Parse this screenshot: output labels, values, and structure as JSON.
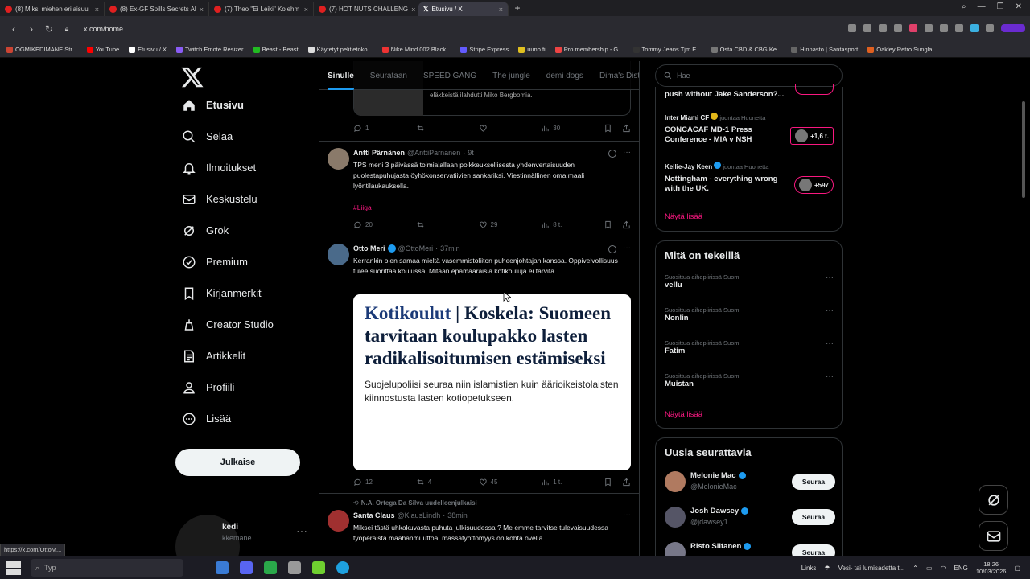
{
  "browser": {
    "tabs": [
      {
        "label": "(8) Miksi miehen erilaisuu",
        "active": false
      },
      {
        "label": "(8) Ex-GF Spills Secrets Al",
        "active": false
      },
      {
        "label": "(7) Theo \"Ei Leiki\" Kolehm",
        "active": false
      },
      {
        "label": "(7) HOT NUTS CHALLENG",
        "active": false
      },
      {
        "label": "Etusivu / X",
        "active": true
      }
    ],
    "url": "x.com/home",
    "bookmarks": [
      "OGMIKEDIMANE Str...",
      "YouTube",
      "Etusivu / X",
      "Twitch Emote Resizer",
      "Beast - Beast",
      "Käytetyt pelitietoko...",
      "Nike Mind 002 Black...",
      "Stripe Express",
      "uuno.fi",
      "Pro membership - G...",
      "Tommy Jeans Tjm E...",
      "Osta CBD & CBG Ke...",
      "Hinnasto | Santasport",
      "Oakley Retro Sungla..."
    ],
    "status_url": "https://x.com/OttoM..."
  },
  "nav": {
    "items": [
      {
        "label": "Etusivu",
        "icon": "home-icon",
        "active": true
      },
      {
        "label": "Selaa",
        "icon": "search-icon",
        "active": false
      },
      {
        "label": "Ilmoitukset",
        "icon": "bell-icon",
        "active": false
      },
      {
        "label": "Keskustelu",
        "icon": "mail-icon",
        "active": false
      },
      {
        "label": "Grok",
        "icon": "grok-icon",
        "active": false
      },
      {
        "label": "Premium",
        "icon": "premium-icon",
        "active": false
      },
      {
        "label": "Kirjanmerkit",
        "icon": "bookmark-icon",
        "active": false
      },
      {
        "label": "Creator Studio",
        "icon": "creator-icon",
        "active": false
      },
      {
        "label": "Artikkelit",
        "icon": "article-icon",
        "active": false
      },
      {
        "label": "Profiili",
        "icon": "profile-icon",
        "active": false
      },
      {
        "label": "Lisää",
        "icon": "more-icon",
        "active": false
      }
    ],
    "post_button": "Julkaise",
    "account": {
      "name": "kedi",
      "handle": "kkemane"
    }
  },
  "feed": {
    "tabs": [
      "Sinulle",
      "Seurataan",
      "SPEED GANG",
      "The jungle",
      "demi dogs",
      "Dima's Dist"
    ],
    "quoted_tail_text": "eläkkeistä ilahdutti Miko Bergbomia.",
    "post0_actions": {
      "reply": "1",
      "repost": "",
      "like": "",
      "views": "30"
    },
    "posts": [
      {
        "name": "Antti Pärnänen",
        "handle": "@AnttiParnanen",
        "time": "9t",
        "text": "TPS meni 3 päivässä toimialallaan poikkeuksellisesta yhdenvertaisuuden puolestapuhujasta öyhökonservatiivien sankariksi. Viestinnällinen oma maali lyöntilaukauksella.",
        "hashtag": "#Liiga",
        "reply": "20",
        "repost": "",
        "like": "29",
        "views": "8 t."
      },
      {
        "name": "Otto Meri",
        "handle": "@OttoMeri",
        "time": "37min",
        "text": "Kerrankin olen samaa mieltä vasemmistoliiton puheenjohtajan kanssa. Oppivelvollisuus tulee suorittaa koulussa. Mitään epämääräisiä kotikouluja ei tarvita.",
        "card_keyword": "Kotikoulut",
        "card_headline_rest": " | Koskela: Suomeen tarvitaan koulupakko lasten radikalisoitumisen estämiseksi",
        "card_sub": "Suojelupoliisi seuraa niin islamistien kuin äärioikeistolaisten kiinnostusta lasten kotiopetukseen.",
        "reply": "12",
        "repost": "4",
        "like": "45",
        "views": "1 t."
      },
      {
        "repost_by": "N.A. Ortega Da Silva uudelleenjulkaisi",
        "name": "Santa Claus",
        "handle": "@KlausLindh",
        "time": "38min",
        "text": "Miksei tästä uhkakuvasta puhuta julkisuudessa ? Me emme tarvitse tulevaisuudessa työperäistä maahanmuuttoa, massatyöttömyys on kohta ovella"
      }
    ]
  },
  "right": {
    "search_placeholder": "Hae",
    "live": [
      {
        "title": "push without Jake Sanderson?...",
        "pill": ""
      },
      {
        "host": "Inter Miami CF",
        "suffix": "juontaa Huonetta",
        "title": "CONCACAF MD-1 Press Conference - MIA v NSH",
        "pill": "+1,6 t."
      },
      {
        "host": "Kellie-Jay Keen",
        "suffix": "juontaa Huonetta",
        "title": "Nottingham - everything wrong with the UK.",
        "pill": "+597"
      }
    ],
    "show_more": "Näytä lisää",
    "trends_title": "Mitä on tekeillä",
    "trends": [
      {
        "meta": "Suosittua aihepiirissä Suomi",
        "title": "vellu"
      },
      {
        "meta": "Suosittua aihepiirissä Suomi",
        "title": "Nonlin"
      },
      {
        "meta": "Suosittua aihepiirissä Suomi",
        "title": "Fatim"
      },
      {
        "meta": "Suosittua aihepiirissä Suomi",
        "title": "Muistan"
      }
    ],
    "follow_title": "Uusia seurattavia",
    "follow": [
      {
        "name": "Melonie Mac",
        "handle": "@MelonieMac",
        "btn": "Seuraa"
      },
      {
        "name": "Josh Dawsey",
        "handle": "@jdawsey1",
        "btn": "Seuraa"
      },
      {
        "name": "Risto Siltanen",
        "handle": "",
        "btn": "Seuraa"
      }
    ]
  },
  "taskbar": {
    "search": "Typ",
    "links": "Links",
    "weather": "Vesi- tai lumisadetta t...",
    "lang": "ENG",
    "time": "18.26",
    "date": "10/03/2026"
  },
  "colors": {
    "accent": "#1d9bf0",
    "pink": "#f91880",
    "bg": "#000000",
    "border": "#2f3336"
  }
}
